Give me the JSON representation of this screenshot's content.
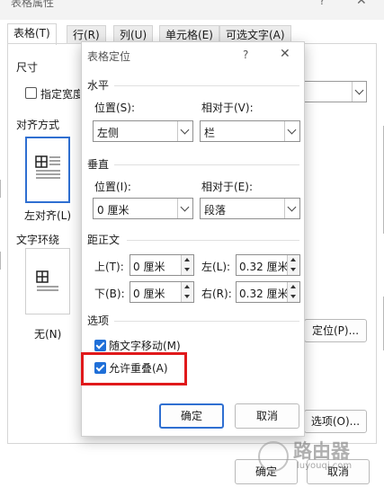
{
  "outer_dialog": {
    "title": "表格属性",
    "tabs": [
      "表格(T)",
      "行(R)",
      "列(U)",
      "单元格(E)",
      "可选文字(A)"
    ],
    "size_label": "尺寸",
    "specify_width_label": "指定宽度",
    "alignment_label": "对齐方式",
    "align_left_label": "左对齐(L)",
    "wrap_label": "文字环绕",
    "wrap_none_label": "无(N)",
    "positioning_button": "定位(P)...",
    "options_button": "选项(O)...",
    "ok_button": "确定",
    "cancel_button": "取消"
  },
  "inner_dialog": {
    "title": "表格定位",
    "help": "?",
    "horizontal": {
      "section": "水平",
      "position_label": "位置(S):",
      "position_value": "左侧",
      "relative_label": "相对于(V):",
      "relative_value": "栏"
    },
    "vertical": {
      "section": "垂直",
      "position_label": "位置(I):",
      "position_value": "0 厘米",
      "relative_label": "相对于(E):",
      "relative_value": "段落"
    },
    "distance": {
      "section": "距正文",
      "top_label": "上(T):",
      "top_value": "0 厘米",
      "left_label": "左(L):",
      "left_value": "0.32 厘米",
      "bottom_label": "下(B):",
      "bottom_value": "0 厘米",
      "right_label": "右(R):",
      "right_value": "0.32 厘米"
    },
    "options": {
      "section": "选项",
      "move_with_text": "随文字移动(M)",
      "move_with_text_checked": true,
      "allow_overlap": "允许重叠(A)",
      "allow_overlap_checked": true
    },
    "ok_button": "确定",
    "cancel_button": "取消"
  },
  "watermark": {
    "title": "路由器",
    "url": "luyouqi.com"
  },
  "colors": {
    "accent": "#2f6fd1",
    "checkbox": "#1f6fd8",
    "highlight_box": "#e0191b"
  }
}
